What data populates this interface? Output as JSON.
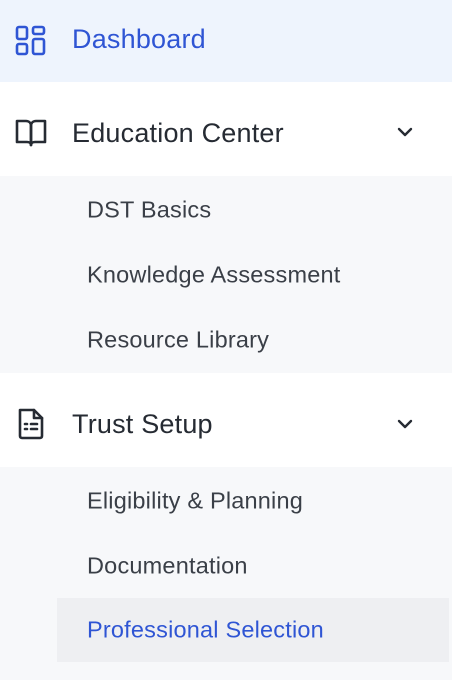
{
  "nav": {
    "dashboard": {
      "label": "Dashboard",
      "icon": "dashboard-grid-icon"
    },
    "education_center": {
      "label": "Education Center",
      "icon": "book-open-icon",
      "expanded": true,
      "children": [
        {
          "label": "DST Basics"
        },
        {
          "label": "Knowledge Assessment"
        },
        {
          "label": "Resource Library"
        }
      ]
    },
    "trust_setup": {
      "label": "Trust Setup",
      "icon": "file-document-icon",
      "expanded": true,
      "children": [
        {
          "label": "Eligibility & Planning"
        },
        {
          "label": "Documentation"
        },
        {
          "label": "Professional Selection",
          "selected": true
        }
      ]
    }
  },
  "colors": {
    "accent": "#2f55d4",
    "active_background": "#eef4fd",
    "submenu_background": "#f7f8fa",
    "selected_item_background": "#eeeff2",
    "text_primary": "#262b33",
    "text_secondary": "#3a3f47"
  }
}
